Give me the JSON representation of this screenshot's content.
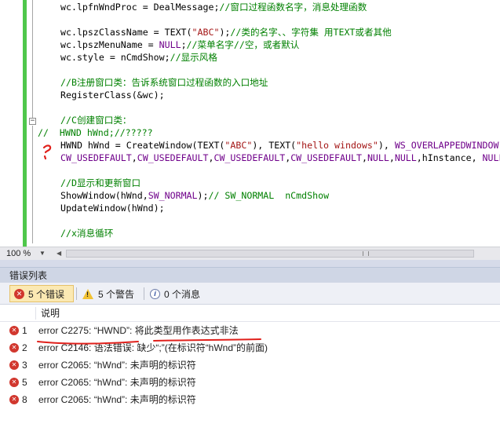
{
  "editor": {
    "lines": [
      [
        {
          "t": "wc.lpfnWndProc = DealMessage;",
          "c": ""
        },
        {
          "t": "//窗口过程函数名字，消息处理函数",
          "c": "cm"
        }
      ],
      [],
      [
        {
          "t": "wc.lpszClassName = TEXT(",
          "c": ""
        },
        {
          "t": "\"ABC\"",
          "c": "str"
        },
        {
          "t": ");",
          "c": ""
        },
        {
          "t": "//类的名字、、字符集 用TEXT或者其他",
          "c": "cm"
        }
      ],
      [
        {
          "t": "wc.lpszMenuName = ",
          "c": ""
        },
        {
          "t": "NULL",
          "c": "mac"
        },
        {
          "t": ";",
          "c": ""
        },
        {
          "t": "//菜单名字//空，或者默认",
          "c": "cm"
        }
      ],
      [
        {
          "t": "wc.style = nCmdShow;",
          "c": ""
        },
        {
          "t": "//显示风格",
          "c": "cm"
        }
      ],
      [],
      [
        {
          "t": "//B注册窗口类：告诉系统窗口过程函数的入口地址",
          "c": "cm"
        }
      ],
      [
        {
          "t": "RegisterClass(&wc);",
          "c": ""
        }
      ],
      [],
      [
        {
          "t": "//C创建窗口类：",
          "c": "cm"
        }
      ],
      [
        {
          "t": "HWND hWnd;//?????",
          "c": "cm"
        }
      ],
      [
        {
          "t": "HWND hWnd = CreateWindow(TEXT(",
          "c": ""
        },
        {
          "t": "\"ABC\"",
          "c": "str"
        },
        {
          "t": "), TEXT(",
          "c": ""
        },
        {
          "t": "\"hello windows\"",
          "c": "str"
        },
        {
          "t": "), ",
          "c": ""
        },
        {
          "t": "WS_OVERLAPPEDWINDOW",
          "c": "mac"
        }
      ],
      [
        {
          "t": "CW_USEDEFAULT",
          "c": "mac"
        },
        {
          "t": ",",
          "c": ""
        },
        {
          "t": "CW_USEDEFAULT",
          "c": "mac"
        },
        {
          "t": ",",
          "c": ""
        },
        {
          "t": "CW_USEDEFAULT",
          "c": "mac"
        },
        {
          "t": ",",
          "c": ""
        },
        {
          "t": "CW_USEDEFAULT",
          "c": "mac"
        },
        {
          "t": ",",
          "c": ""
        },
        {
          "t": "NULL",
          "c": "mac"
        },
        {
          "t": ",",
          "c": ""
        },
        {
          "t": "NULL",
          "c": "mac"
        },
        {
          "t": ",hInstance, ",
          "c": ""
        },
        {
          "t": "NULL",
          "c": "mac"
        }
      ],
      [],
      [
        {
          "t": "//D显示和更新窗口",
          "c": "cm"
        }
      ],
      [
        {
          "t": "ShowWindow(hWnd,",
          "c": ""
        },
        {
          "t": "SW_NORMAL",
          "c": "mac"
        },
        {
          "t": ");",
          "c": ""
        },
        {
          "t": "// SW_NORMAL  nCmdShow",
          "c": "cm"
        }
      ],
      [
        {
          "t": "UpdateWindow(hWnd);",
          "c": ""
        }
      ],
      [],
      [
        {
          "t": "//x消息循环",
          "c": "cm"
        }
      ]
    ],
    "commented_prefix": "//"
  },
  "status": {
    "zoom": "100 %"
  },
  "error_list": {
    "title": "错误列表",
    "filters": {
      "errors": "5 个错误",
      "warnings": "5 个警告",
      "messages": "0 个消息"
    },
    "columns": {
      "description": "说明"
    },
    "rows": [
      {
        "num": "1",
        "desc": "error C2275: “HWND”: 将此类型用作表达式非法"
      },
      {
        "num": "2",
        "desc": "error C2146: 语法错误: 缺少“;”(在标识符“hWnd”的前面)"
      },
      {
        "num": "3",
        "desc": "error C2065: “hWnd”: 未声明的标识符"
      },
      {
        "num": "5",
        "desc": "error C2065: “hWnd”: 未声明的标识符"
      },
      {
        "num": "8",
        "desc": "error C2065: “hWnd”: 未声明的标识符"
      }
    ]
  },
  "colors": {
    "comment": "#008000",
    "string": "#a31515",
    "macro": "#6f008a",
    "change_bar": "#4fc74b",
    "error_icon": "#d1372e",
    "annotation_ink": "#e0201b"
  }
}
